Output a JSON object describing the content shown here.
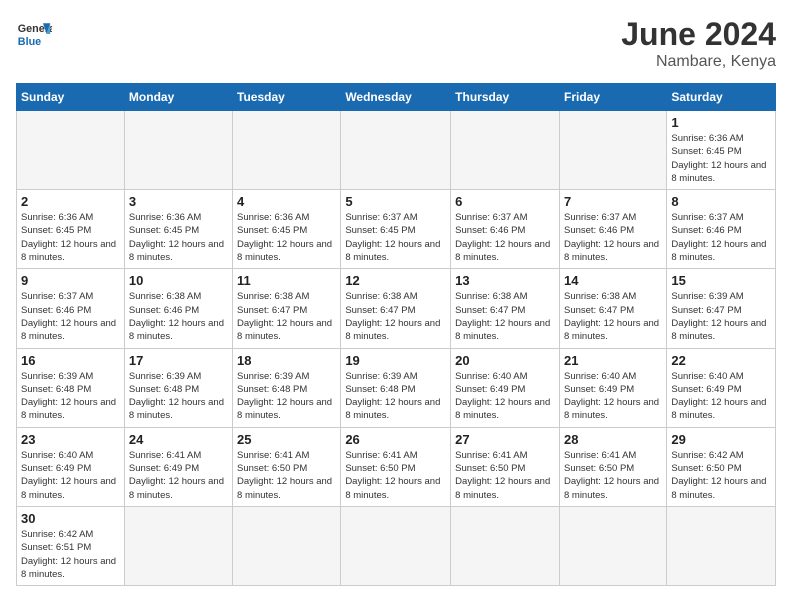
{
  "header": {
    "logo_general": "General",
    "logo_blue": "Blue",
    "title": "June 2024",
    "subtitle": "Nambare, Kenya"
  },
  "weekdays": [
    "Sunday",
    "Monday",
    "Tuesday",
    "Wednesday",
    "Thursday",
    "Friday",
    "Saturday"
  ],
  "weeks": [
    [
      {
        "day": "",
        "empty": true
      },
      {
        "day": "",
        "empty": true
      },
      {
        "day": "",
        "empty": true
      },
      {
        "day": "",
        "empty": true
      },
      {
        "day": "",
        "empty": true
      },
      {
        "day": "",
        "empty": true
      },
      {
        "day": "1",
        "sunrise": "6:36 AM",
        "sunset": "6:45 PM",
        "daylight": "12 hours and 8 minutes."
      }
    ],
    [
      {
        "day": "2",
        "sunrise": "6:36 AM",
        "sunset": "6:45 PM",
        "daylight": "12 hours and 8 minutes."
      },
      {
        "day": "3",
        "sunrise": "6:36 AM",
        "sunset": "6:45 PM",
        "daylight": "12 hours and 8 minutes."
      },
      {
        "day": "4",
        "sunrise": "6:36 AM",
        "sunset": "6:45 PM",
        "daylight": "12 hours and 8 minutes."
      },
      {
        "day": "5",
        "sunrise": "6:37 AM",
        "sunset": "6:45 PM",
        "daylight": "12 hours and 8 minutes."
      },
      {
        "day": "6",
        "sunrise": "6:37 AM",
        "sunset": "6:46 PM",
        "daylight": "12 hours and 8 minutes."
      },
      {
        "day": "7",
        "sunrise": "6:37 AM",
        "sunset": "6:46 PM",
        "daylight": "12 hours and 8 minutes."
      },
      {
        "day": "8",
        "sunrise": "6:37 AM",
        "sunset": "6:46 PM",
        "daylight": "12 hours and 8 minutes."
      }
    ],
    [
      {
        "day": "9",
        "sunrise": "6:37 AM",
        "sunset": "6:46 PM",
        "daylight": "12 hours and 8 minutes."
      },
      {
        "day": "10",
        "sunrise": "6:38 AM",
        "sunset": "6:46 PM",
        "daylight": "12 hours and 8 minutes."
      },
      {
        "day": "11",
        "sunrise": "6:38 AM",
        "sunset": "6:47 PM",
        "daylight": "12 hours and 8 minutes."
      },
      {
        "day": "12",
        "sunrise": "6:38 AM",
        "sunset": "6:47 PM",
        "daylight": "12 hours and 8 minutes."
      },
      {
        "day": "13",
        "sunrise": "6:38 AM",
        "sunset": "6:47 PM",
        "daylight": "12 hours and 8 minutes."
      },
      {
        "day": "14",
        "sunrise": "6:38 AM",
        "sunset": "6:47 PM",
        "daylight": "12 hours and 8 minutes."
      },
      {
        "day": "15",
        "sunrise": "6:39 AM",
        "sunset": "6:47 PM",
        "daylight": "12 hours and 8 minutes."
      }
    ],
    [
      {
        "day": "16",
        "sunrise": "6:39 AM",
        "sunset": "6:48 PM",
        "daylight": "12 hours and 8 minutes."
      },
      {
        "day": "17",
        "sunrise": "6:39 AM",
        "sunset": "6:48 PM",
        "daylight": "12 hours and 8 minutes."
      },
      {
        "day": "18",
        "sunrise": "6:39 AM",
        "sunset": "6:48 PM",
        "daylight": "12 hours and 8 minutes."
      },
      {
        "day": "19",
        "sunrise": "6:39 AM",
        "sunset": "6:48 PM",
        "daylight": "12 hours and 8 minutes."
      },
      {
        "day": "20",
        "sunrise": "6:40 AM",
        "sunset": "6:49 PM",
        "daylight": "12 hours and 8 minutes."
      },
      {
        "day": "21",
        "sunrise": "6:40 AM",
        "sunset": "6:49 PM",
        "daylight": "12 hours and 8 minutes."
      },
      {
        "day": "22",
        "sunrise": "6:40 AM",
        "sunset": "6:49 PM",
        "daylight": "12 hours and 8 minutes."
      }
    ],
    [
      {
        "day": "23",
        "sunrise": "6:40 AM",
        "sunset": "6:49 PM",
        "daylight": "12 hours and 8 minutes."
      },
      {
        "day": "24",
        "sunrise": "6:41 AM",
        "sunset": "6:49 PM",
        "daylight": "12 hours and 8 minutes."
      },
      {
        "day": "25",
        "sunrise": "6:41 AM",
        "sunset": "6:50 PM",
        "daylight": "12 hours and 8 minutes."
      },
      {
        "day": "26",
        "sunrise": "6:41 AM",
        "sunset": "6:50 PM",
        "daylight": "12 hours and 8 minutes."
      },
      {
        "day": "27",
        "sunrise": "6:41 AM",
        "sunset": "6:50 PM",
        "daylight": "12 hours and 8 minutes."
      },
      {
        "day": "28",
        "sunrise": "6:41 AM",
        "sunset": "6:50 PM",
        "daylight": "12 hours and 8 minutes."
      },
      {
        "day": "29",
        "sunrise": "6:42 AM",
        "sunset": "6:50 PM",
        "daylight": "12 hours and 8 minutes."
      }
    ],
    [
      {
        "day": "30",
        "sunrise": "6:42 AM",
        "sunset": "6:51 PM",
        "daylight": "12 hours and 8 minutes."
      },
      {
        "day": "",
        "empty": true
      },
      {
        "day": "",
        "empty": true
      },
      {
        "day": "",
        "empty": true
      },
      {
        "day": "",
        "empty": true
      },
      {
        "day": "",
        "empty": true
      },
      {
        "day": "",
        "empty": true
      }
    ]
  ]
}
